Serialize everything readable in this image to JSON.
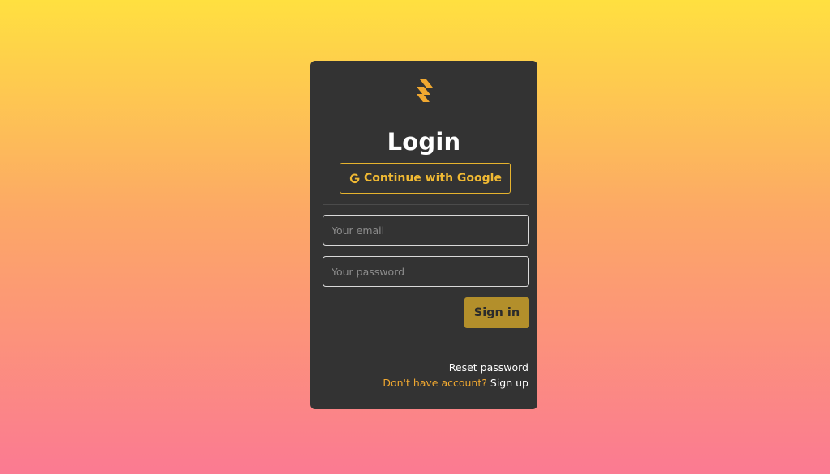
{
  "login": {
    "title": "Login",
    "google_button_label": "Continue with Google",
    "email_placeholder": "Your email",
    "password_placeholder": "Your password",
    "signin_label": "Sign in",
    "reset_password_label": "Reset password",
    "no_account_text": "Don't have account?",
    "signup_label": "Sign up"
  },
  "icons": {
    "logo": "supabase-logo-icon",
    "google": "google-g-icon"
  },
  "colors": {
    "card_background": "#333333",
    "accent": "#f0b933",
    "signin_button": "#b38f2b"
  }
}
